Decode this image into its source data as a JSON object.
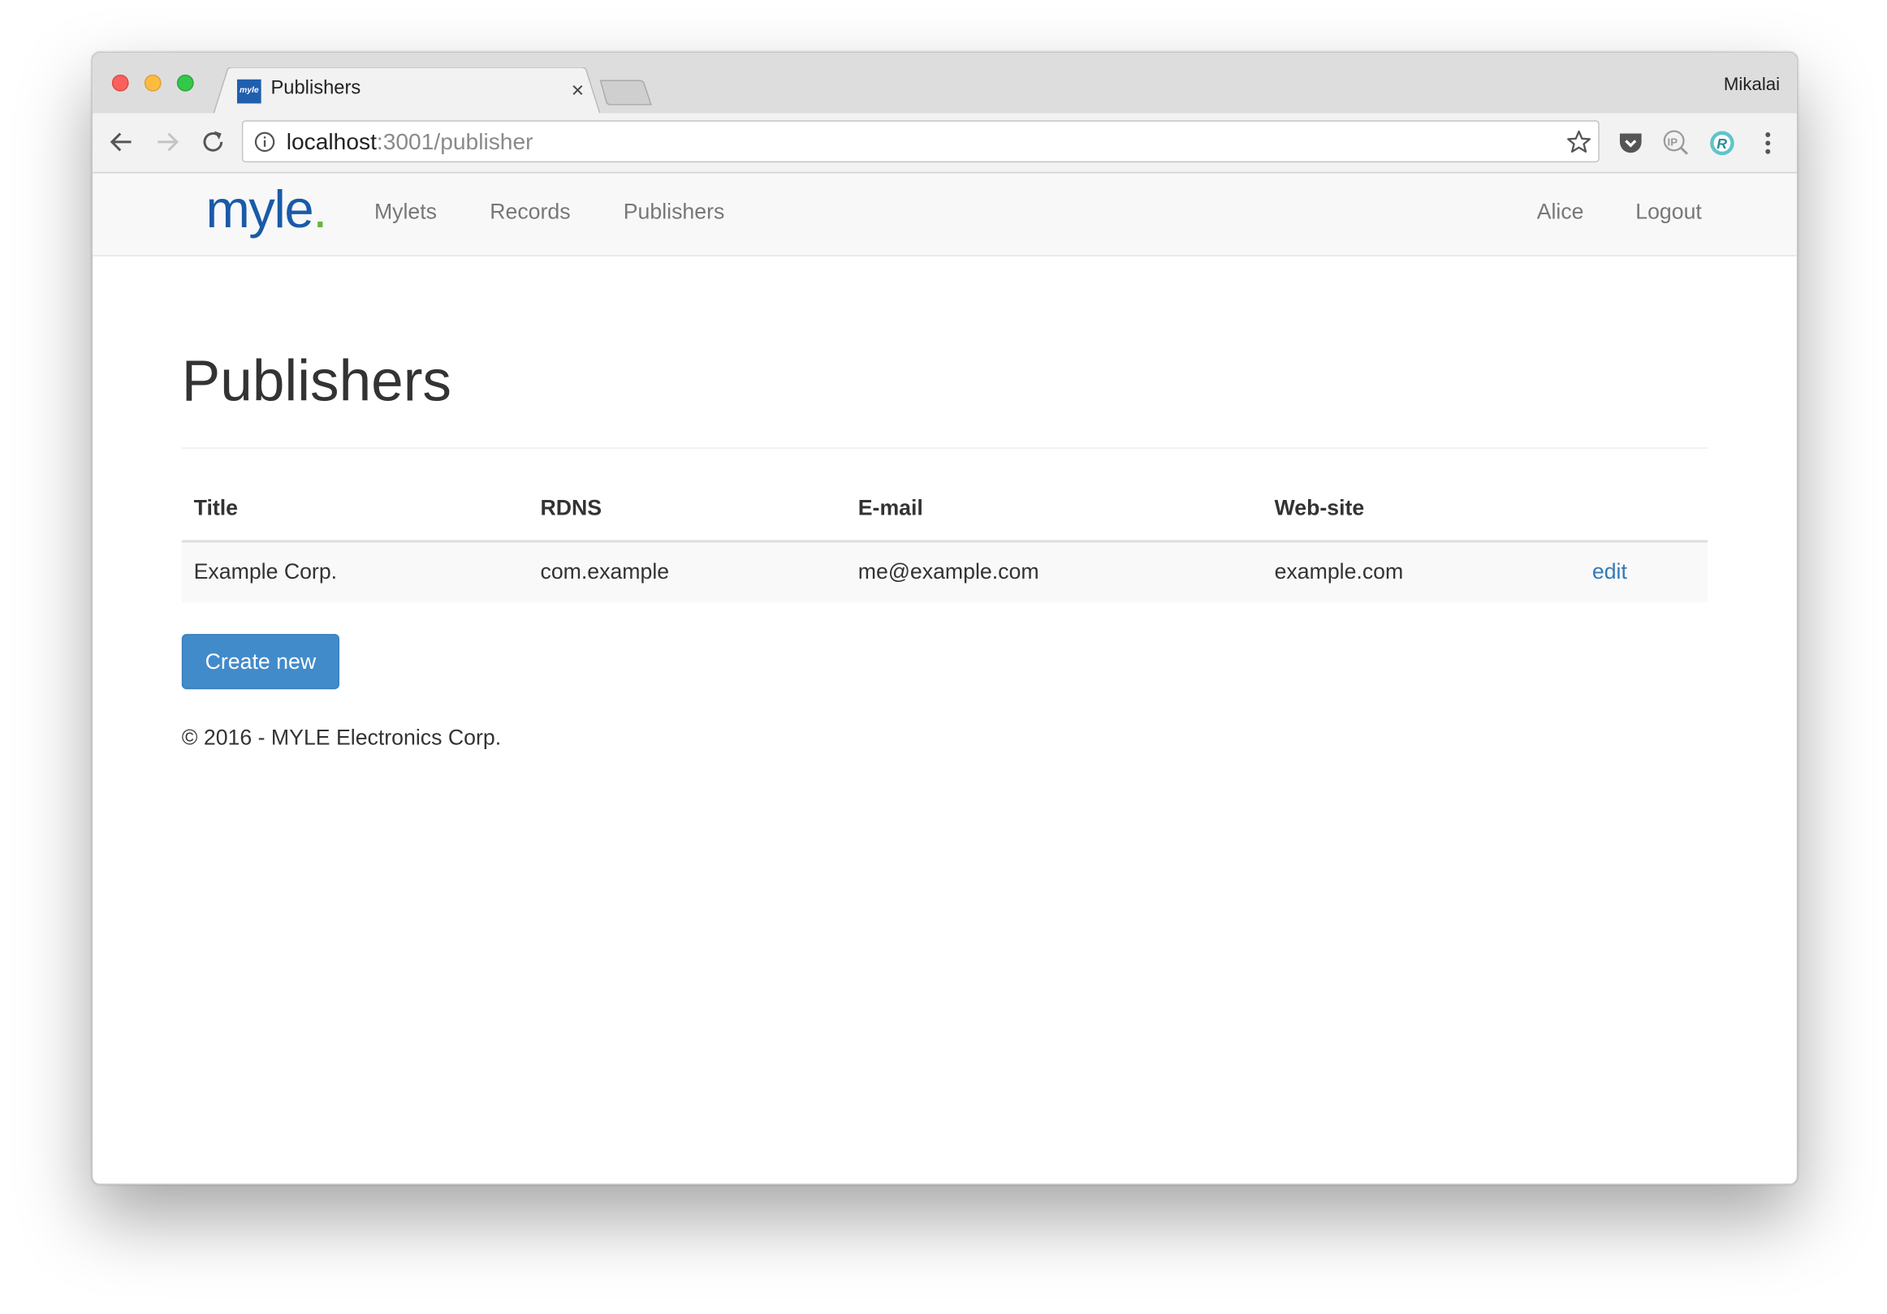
{
  "browser": {
    "tab_title": "Publishers",
    "favicon_text": "myle",
    "profile_name": "Mikalai",
    "url_host": "localhost",
    "url_rest": ":3001/publisher"
  },
  "navbar": {
    "brand": "myle",
    "brand_dot": ".",
    "links": [
      "Mylets",
      "Records",
      "Publishers"
    ],
    "user": "Alice",
    "logout": "Logout"
  },
  "page": {
    "title": "Publishers",
    "columns": [
      "Title",
      "RDNS",
      "E-mail",
      "Web-site"
    ],
    "rows": [
      {
        "title": "Example Corp.",
        "rdns": "com.example",
        "email": "me@example.com",
        "website": "example.com",
        "action": "edit"
      }
    ],
    "create_button": "Create new",
    "footer": "© 2016 - MYLE Electronics Corp."
  },
  "colors": {
    "brand_blue": "#1a5aa8",
    "brand_green": "#6cb33f",
    "primary_button": "#428bca",
    "link": "#337ab7"
  }
}
